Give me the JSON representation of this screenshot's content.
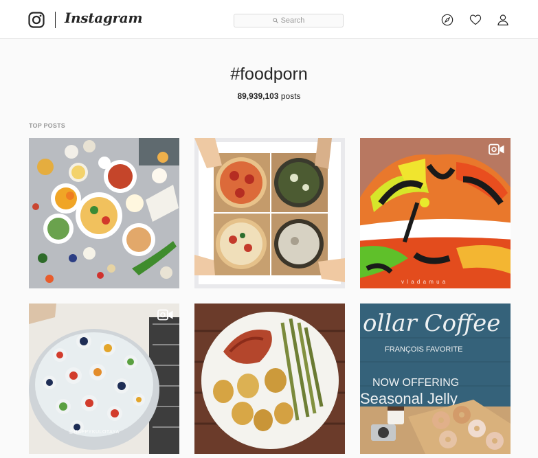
{
  "header": {
    "brand": "Instagram",
    "search_placeholder": "Search",
    "icons": [
      "instagram-logo-icon",
      "search-icon",
      "compass-icon",
      "heart-icon",
      "profile-icon"
    ]
  },
  "hashtag": {
    "title": "#foodporn",
    "post_count": "89,939,103",
    "post_count_suffix": " posts"
  },
  "section": {
    "label": "TOP POSTS"
  },
  "posts": [
    {
      "name": "post-flatlay-fruit-salads",
      "video": false
    },
    {
      "name": "post-pizzas-in-boxes",
      "video": false
    },
    {
      "name": "post-painted-lips",
      "video": true,
      "watermark": "v l a d a m u a"
    },
    {
      "name": "post-jelly-cake",
      "video": true,
      "watermark": "@HAPPYKULOTAYA"
    },
    {
      "name": "post-chicken-potatoes-asparagus",
      "video": false
    },
    {
      "name": "post-coffee-donuts",
      "video": false,
      "sign_text": [
        "ollar Coffee",
        "FRANÇOIS FAVORITE",
        "NOW OFFERING",
        "Seasonal Jelly"
      ]
    }
  ]
}
